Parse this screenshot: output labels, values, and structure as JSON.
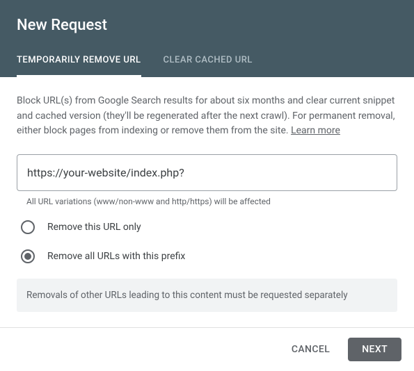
{
  "header": {
    "title": "New Request",
    "tabs": [
      {
        "label": "TEMPORARILY REMOVE URL",
        "active": true
      },
      {
        "label": "CLEAR CACHED URL",
        "active": false
      }
    ]
  },
  "content": {
    "description": "Block URL(s) from Google Search results for about six months and clear current snippet and cached version (they'll be regenerated after the next crawl). For permanent removal, either block pages from indexing or remove them from the site. ",
    "learn_more": "Learn more",
    "url_input_value": "https://your-website/index.php?",
    "url_helper": "All URL variations (www/non-www and http/https) will be affected",
    "radios": [
      {
        "label": "Remove this URL only",
        "checked": false
      },
      {
        "label": "Remove all URLs with this prefix",
        "checked": true
      }
    ],
    "info_banner": "Removals of other URLs leading to this content must be requested separately"
  },
  "footer": {
    "cancel": "CANCEL",
    "next": "NEXT"
  }
}
